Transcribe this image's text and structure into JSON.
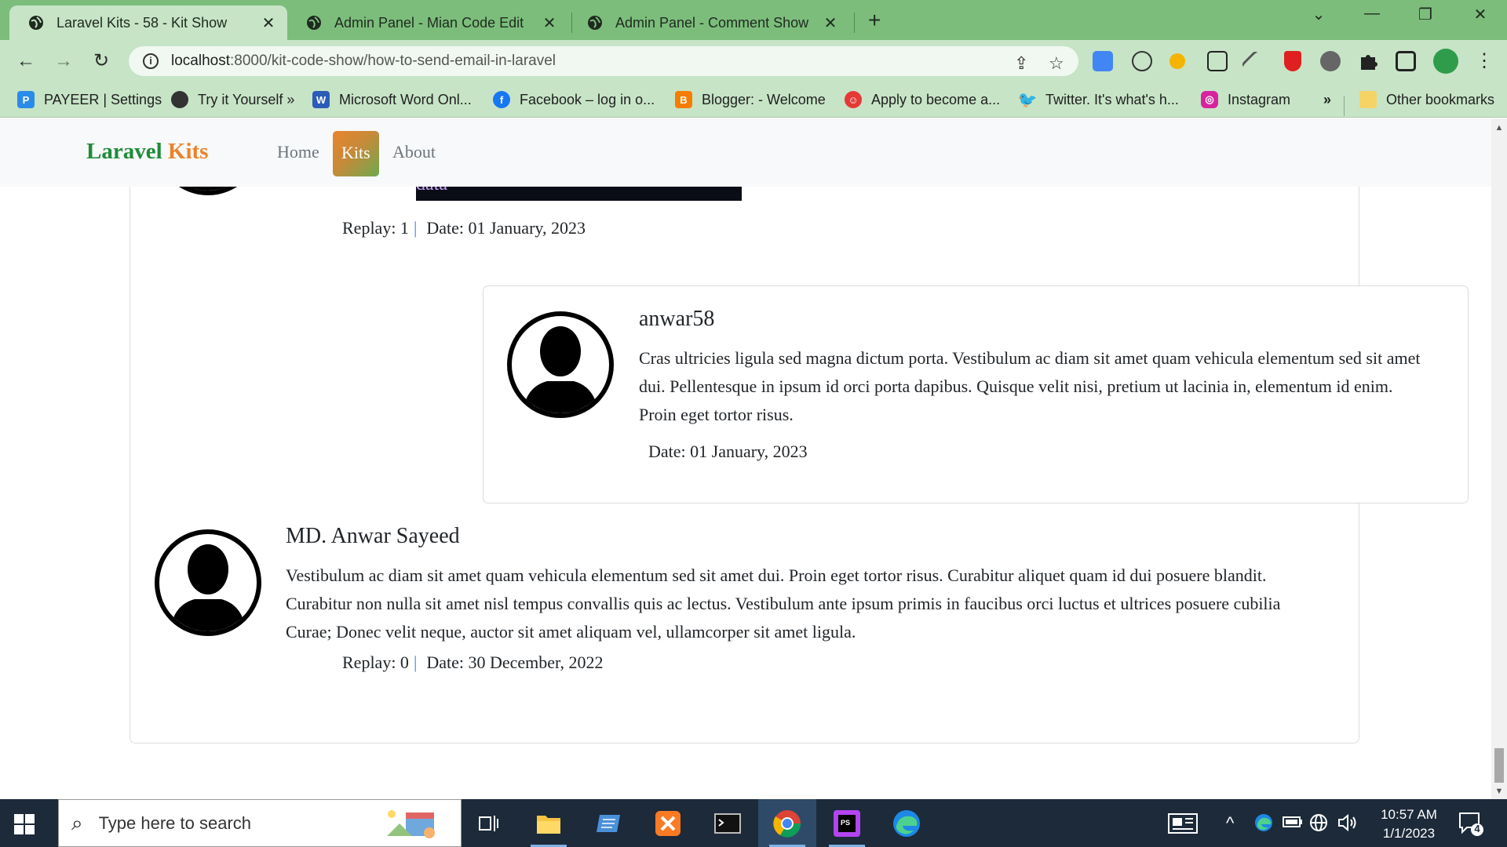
{
  "browser": {
    "tabs": [
      {
        "title": "Laravel Kits - 58 - Kit Show",
        "active": true
      },
      {
        "title": "Admin Panel - Mian Code Edit",
        "active": false
      },
      {
        "title": "Admin Panel - Comment Show",
        "active": false
      }
    ],
    "url_host": "localhost",
    "url_path": ":8000/kit-code-show/how-to-send-email-in-laravel",
    "bookmarks": [
      {
        "label": "PAYEER | Settings",
        "icon": "payeer-icon",
        "color": "#2b8be8"
      },
      {
        "label": "Try it Yourself »",
        "icon": "globe-icon",
        "color": "#333333"
      },
      {
        "label": "Microsoft Word Onl...",
        "icon": "word-icon",
        "color": "#2b5cb8"
      },
      {
        "label": "Facebook – log in o...",
        "icon": "facebook-icon",
        "color": "#1877f2"
      },
      {
        "label": "Blogger: - Welcome",
        "icon": "blogger-icon",
        "color": "#f57d00"
      },
      {
        "label": "Apply to become a...",
        "icon": "fiverr-face-icon",
        "color": "#e53935"
      },
      {
        "label": "Twitter. It's what's h...",
        "icon": "twitter-icon",
        "color": "#1da1f2"
      },
      {
        "label": "Instagram",
        "icon": "instagram-icon",
        "color": "#d6249f"
      }
    ],
    "bookmarks_more": "»",
    "other_bookmarks": "Other bookmarks"
  },
  "site": {
    "brand_part1": "Laravel",
    "brand_part2": "Kits",
    "nav": [
      {
        "label": "Home",
        "active": false
      },
      {
        "label": "Kits",
        "active": true
      },
      {
        "label": "About",
        "active": false
      }
    ]
  },
  "comments": {
    "first": {
      "highlight_text": "data",
      "replay_label": "Replay: 1",
      "separator": "|",
      "date": "Date: 01 January, 2023"
    },
    "reply": {
      "name": "anwar58",
      "body": "Cras ultricies ligula sed magna dictum porta. Vestibulum ac diam sit amet quam vehicula elementum sed sit amet dui. Pellentesque in ipsum id orci porta dapibus. Quisque velit nisi, pretium ut lacinia in, elementum id enim. Proin eget tortor risus.",
      "date": "Date: 01 January, 2023"
    },
    "second": {
      "name": "MD. Anwar Sayeed",
      "body": "Vestibulum ac diam sit amet quam vehicula elementum sed sit amet dui. Proin eget tortor risus. Curabitur aliquet quam id dui posuere blandit. Curabitur non nulla sit amet nisl tempus convallis quis ac lectus. Vestibulum ante ipsum primis in faucibus orci luctus et ultrices posuere cubilia Curae; Donec velit neque, auctor sit amet aliquam vel, ullamcorper sit amet ligula.",
      "replay_label": "Replay: 0",
      "separator": "|",
      "date": "Date: 30 December, 2022"
    }
  },
  "taskbar": {
    "search_placeholder": "Type here to search",
    "time": "10:57 AM",
    "date": "1/1/2023",
    "notification_count": "4"
  },
  "colors": {
    "tab_strip": "#7cbd7c",
    "toolbar": "#c7e4c7",
    "brand_green": "#1e8c3a",
    "brand_orange": "#e8842c"
  }
}
